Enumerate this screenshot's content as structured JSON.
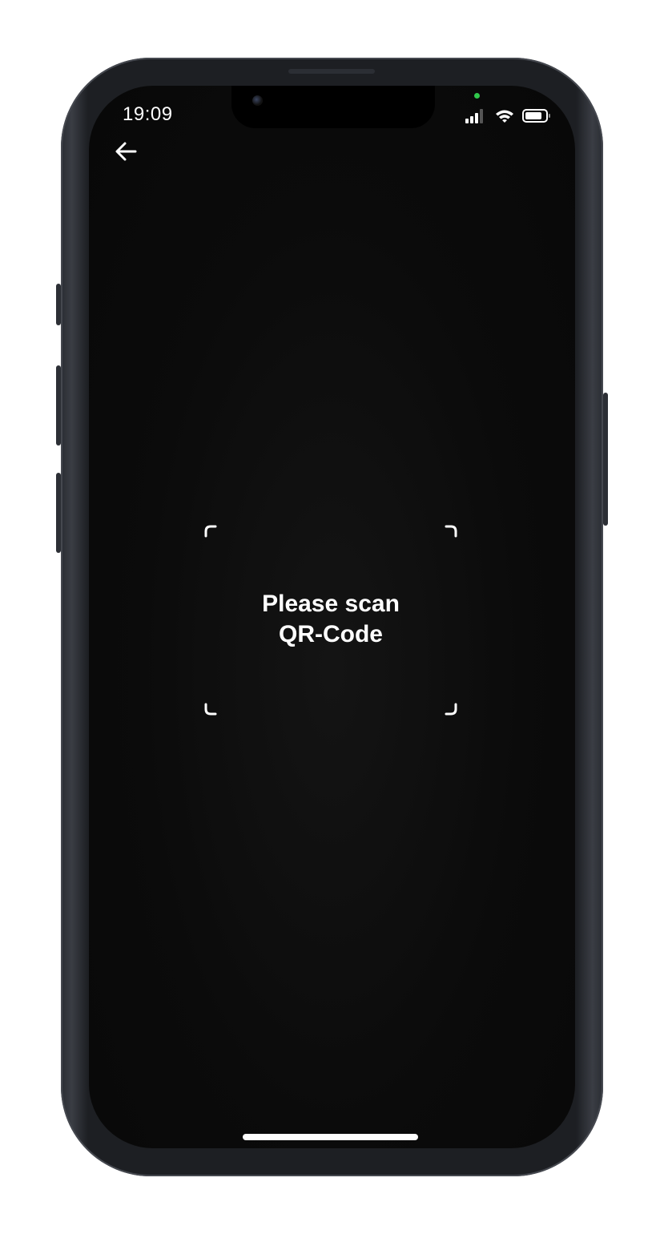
{
  "status_bar": {
    "time": "19:09",
    "icons": [
      "cellular-signal-icon",
      "wifi-icon",
      "battery-icon"
    ]
  },
  "navigation": {
    "back_icon": "arrow-left-icon"
  },
  "scanner": {
    "prompt_line1": "Please scan",
    "prompt_line2": "QR-Code"
  },
  "colors": {
    "background": "#0b0b0b",
    "text": "#ffffff",
    "privacy_indicator": "#30c84b"
  }
}
